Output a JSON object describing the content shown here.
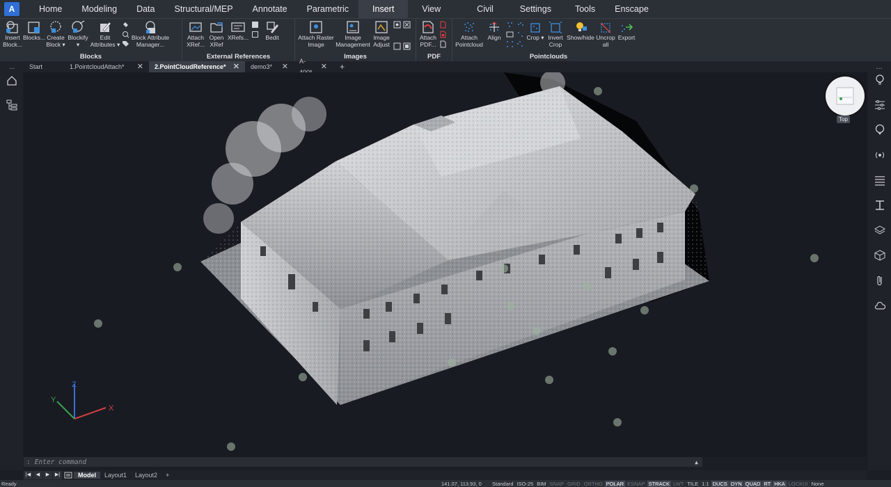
{
  "menu": {
    "app_icon": "A",
    "tabs": [
      "Home",
      "Modeling",
      "Data",
      "Structural/MEP",
      "Annotate",
      "Parametric",
      "Insert",
      "View",
      "Civil",
      "Settings",
      "Tools",
      "Enscape"
    ],
    "active_tab": "Insert"
  },
  "ribbon": {
    "blocks": {
      "title": "Blocks",
      "insert_block": "Insert Block...",
      "blocks": "Blocks...",
      "create_block": "Create Block ▾",
      "blockify": "Blockify ▾",
      "edit_attributes": "Edit Attributes ▾",
      "block_attribute_manager": "Block Attribute Manager..."
    },
    "external_references": {
      "title": "External References",
      "attach_xref": "Attach XRef...",
      "open_xref": "Open XRef",
      "xrefs": "XRefs...",
      "bedit": "Bedit"
    },
    "images": {
      "title": "Images",
      "attach_raster_image": "Attach Raster Image",
      "image_management": "Image Management",
      "image_adjust": "Image Adjust"
    },
    "pdf": {
      "title": "PDF",
      "attach_pdf": "Attach PDF..."
    },
    "pointclouds": {
      "title": "Pointclouds",
      "attach_pointcloud": "Attach Pointcloud",
      "align": "Align",
      "crop": "Crop ▾",
      "invert_crop": "Invert Crop",
      "show_hide": "Show/hide",
      "uncrop_all": "Uncrop all",
      "export": "Export"
    }
  },
  "doc_tabs": {
    "left_dots": "...",
    "tabs": [
      "Start",
      "1.PointcloudAttach*",
      "2.PointCloudReference*",
      "demo3*",
      "A-400*"
    ],
    "active": "2.PointCloudReference*",
    "close_glyph": "✕",
    "add_glyph": "+"
  },
  "viewport": {
    "viewcube_label": "Top",
    "ucs": {
      "x_label": "X",
      "y_label": "Y",
      "z_label": "Z"
    }
  },
  "command": {
    "prompt_mark": ":",
    "placeholder": "Enter command",
    "expand_glyph": "▲"
  },
  "layout_tabs": {
    "nav": [
      "|◀",
      "◀",
      "▶",
      "▶|"
    ],
    "tabs": [
      "Model",
      "Layout1",
      "Layout2"
    ],
    "active": "Model",
    "add": "+"
  },
  "status": {
    "ready": "Ready",
    "coordinates": "141.07, 113.93, 0",
    "items": [
      "Standard",
      "ISO-25",
      "BIM",
      "SNAP",
      "GRID",
      "ORTHO",
      "POLAR",
      "ESNAP",
      "STRACK",
      "LWT",
      "TILE",
      "1:1",
      "DUCS",
      "DYN",
      "QUAD",
      "RT",
      "HKA",
      "LOCKUI",
      "None"
    ],
    "on_items": [
      "POLAR",
      "STRACK",
      "DUCS",
      "DYN",
      "QUAD",
      "RT",
      "HKA"
    ],
    "off_items": [
      "SNAP",
      "GRID",
      "ORTHO",
      "ESNAP",
      "LWT",
      "LOCKUI"
    ]
  }
}
